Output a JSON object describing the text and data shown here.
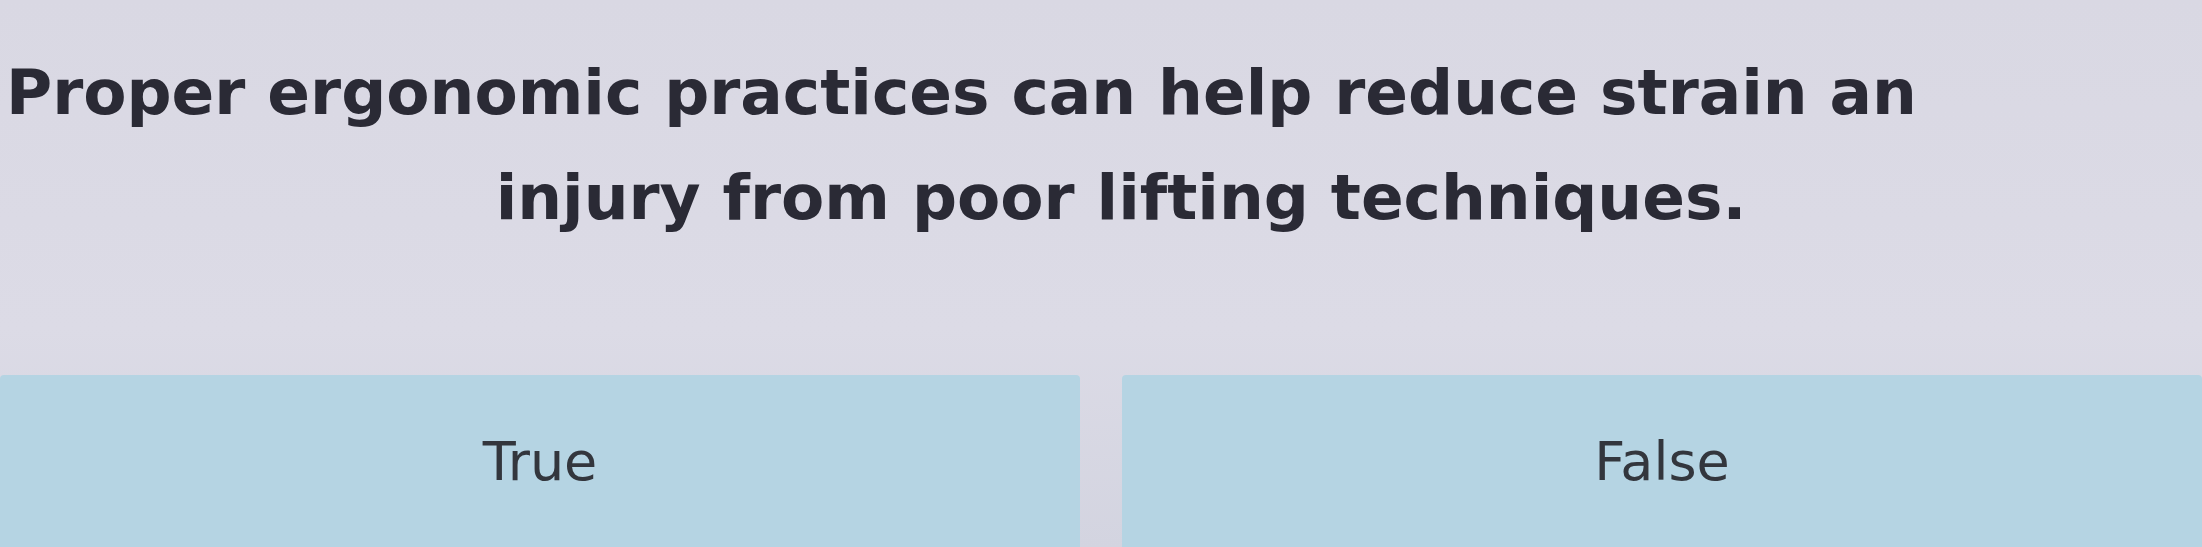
{
  "question": {
    "lines": [
      "Proper ergonomic practices can help reduce strain an",
      "injury from poor lifting techniques."
    ]
  },
  "options": [
    {
      "label": "True",
      "selected": false
    },
    {
      "label": "False",
      "selected": false
    }
  ]
}
